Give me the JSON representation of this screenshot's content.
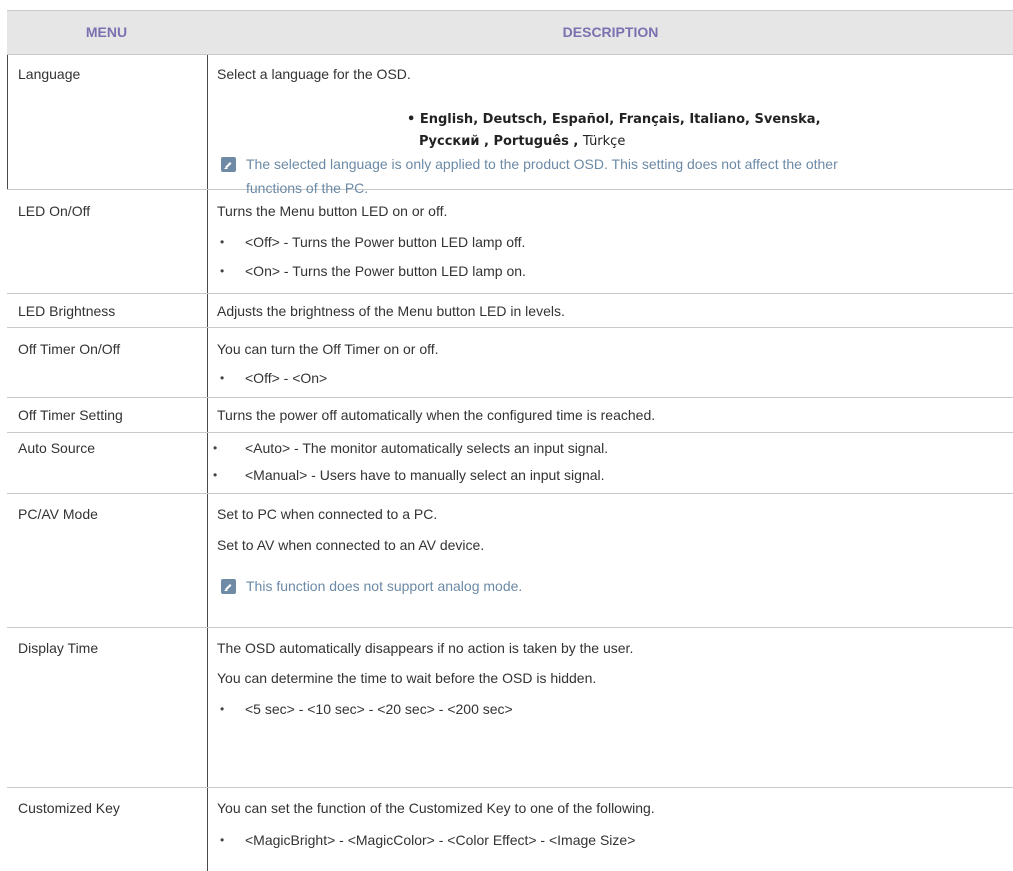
{
  "header": {
    "menu": "MENU",
    "description": "DESCRIPTION"
  },
  "rows": {
    "language": {
      "menu": "Language",
      "desc": "Select a language for the OSD.",
      "languages_line1": "English, Deutsch, Español, Français,  Italiano,",
      "languages_line1_b": "Svenska,",
      "languages_line2_a": "Русский , Português ,",
      "languages_line2_b": "Türkçe",
      "note_line1": "The selected language is only applied to the product OSD. This setting does not affect the other",
      "note_line2": "functions of the PC.",
      "note_icon": "note-icon"
    },
    "led_onoff": {
      "menu": "LED On/Off",
      "desc": "Turns the Menu button LED on or off.",
      "bullet1": "<Off> - Turns the Power button LED lamp off.",
      "bullet2": "<On> - Turns the Power button LED lamp on."
    },
    "led_brightness": {
      "menu": "LED Brightness",
      "desc": "Adjusts the brightness of the Menu button LED in levels."
    },
    "off_timer_onoff": {
      "menu": "Off Timer On/Off",
      "desc": "You can turn the Off Timer on or off.",
      "bullet1": "<Off> - <On>"
    },
    "off_timer_setting": {
      "menu": "Off Timer Setting",
      "desc": "Turns the power off automatically when the configured time is reached."
    },
    "auto_source": {
      "menu": "Auto Source",
      "bullet1": "<Auto> - The monitor automatically selects an input signal.",
      "bullet2": "<Manual> - Users have to manually select an input signal."
    },
    "pc_av_mode": {
      "menu": "PC/AV Mode",
      "desc1": "Set to PC when connected to a PC.",
      "desc2": "Set to AV when connected to an AV device.",
      "note": "This function does not support analog mode.",
      "note_icon": "note-icon"
    },
    "display_time": {
      "menu": "Display Time",
      "desc1": "The OSD automatically disappears if no action is taken by the user.",
      "desc2": "You can determine the time to wait before the OSD is hidden.",
      "bullet1": "<5 sec> - <10 sec> - <20 sec> - <200 sec>"
    },
    "customized_key": {
      "menu": "Customized Key",
      "desc": "You can set the function of the Customized Key to one of the following.",
      "bullet1": "<MagicBright> - <MagicColor> - <Color Effect> - <Image Size>"
    }
  },
  "colors": {
    "header_text": "#7a72b0",
    "header_bg": "#e6e6e6",
    "note_text": "#6c8aa6",
    "note_icon": "#6f8aa5"
  }
}
